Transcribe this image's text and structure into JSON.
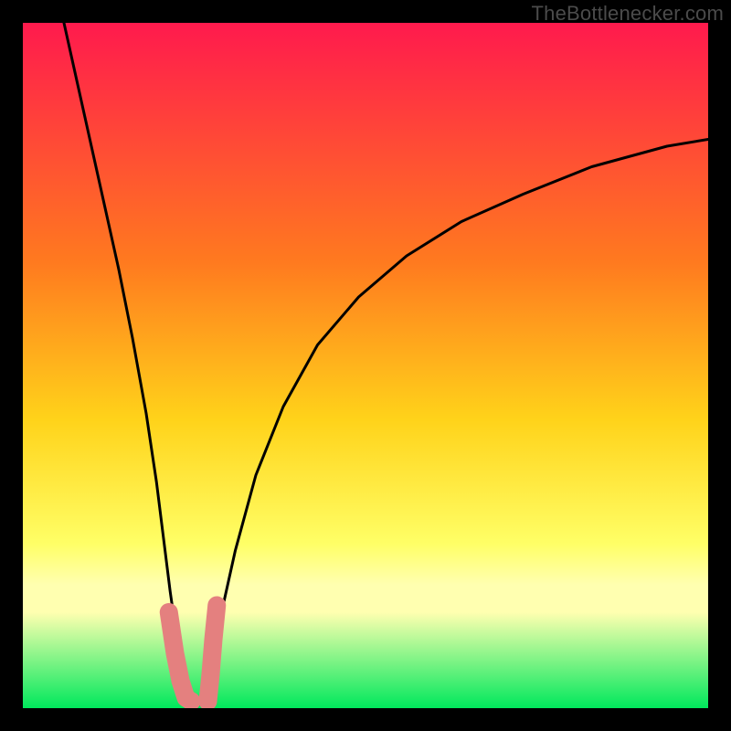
{
  "watermark": "TheBottlenecker.com",
  "colors": {
    "frame": "#000000",
    "watermark": "#4b4b4b",
    "curve": "#000000",
    "highlight": "#e4807f",
    "gradient_top": "#ff1a4d",
    "gradient_mid_upper": "#ff7a1f",
    "gradient_mid": "#ffd31a",
    "gradient_mid_lower": "#ffff66",
    "gradient_band": "#ffffb0",
    "gradient_bottom": "#00e85c"
  },
  "chart_data": {
    "type": "line",
    "title": "",
    "xlabel": "",
    "ylabel": "",
    "xlim": [
      0,
      100
    ],
    "ylim": [
      0,
      100
    ],
    "series": [
      {
        "name": "left-branch",
        "x": [
          6,
          8,
          10,
          12,
          14,
          16,
          18,
          19.5,
          20.5,
          21.5,
          22.5,
          23,
          23.5,
          24
        ],
        "y": [
          100,
          91,
          82,
          73,
          64,
          54,
          43,
          33,
          25,
          17,
          10,
          6,
          3,
          1
        ]
      },
      {
        "name": "right-branch",
        "x": [
          27,
          27.5,
          28,
          29,
          31,
          34,
          38,
          43,
          49,
          56,
          64,
          73,
          83,
          94,
          100
        ],
        "y": [
          1,
          4,
          8,
          14,
          23,
          34,
          44,
          53,
          60,
          66,
          71,
          75,
          79,
          82,
          83
        ]
      }
    ],
    "highlight_segments": [
      {
        "name": "left-foot",
        "x": [
          21.3,
          22.2,
          23.0,
          23.8,
          24.6
        ],
        "y": [
          14,
          8,
          4,
          1.5,
          1
        ]
      },
      {
        "name": "right-foot",
        "x": [
          27.0,
          27.4,
          27.8,
          28.3
        ],
        "y": [
          1,
          5,
          10,
          15
        ]
      }
    ],
    "gradient_stops_pct": [
      0,
      35,
      58,
      76,
      82,
      86,
      100
    ]
  }
}
